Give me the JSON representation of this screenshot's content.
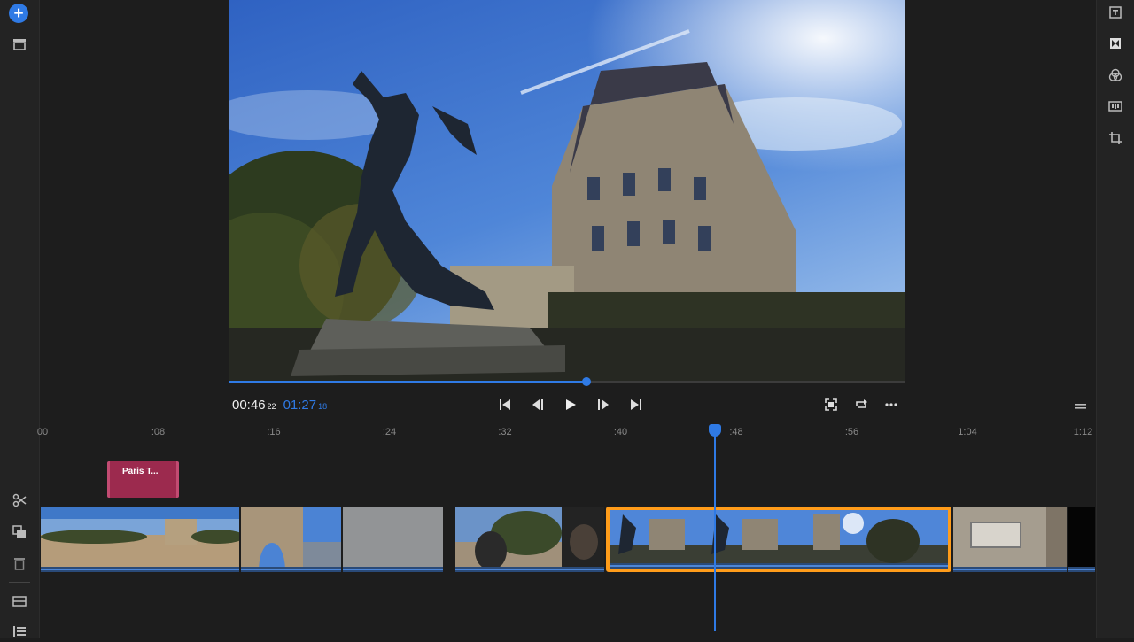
{
  "toolbar_left": {
    "icons": [
      "add-media-icon",
      "media-bin-icon",
      "scissors-icon",
      "duplicate-icon",
      "trash-icon",
      "track-layout-icon",
      "list-view-icon"
    ]
  },
  "toolbar_right": {
    "icons": [
      "text-title-icon",
      "transitions-icon",
      "color-icon",
      "audio-icon",
      "crop-icon"
    ]
  },
  "player": {
    "current_time": "00:46",
    "current_frames": "22",
    "duration": "01:27",
    "duration_frames": "18",
    "progress": 0.53
  },
  "timeline": {
    "ticks": [
      "00",
      ":08",
      ":16",
      ":24",
      ":32",
      ":40",
      ":48",
      ":56",
      "1:04",
      "1:12"
    ],
    "playhead_label": ":48",
    "title_clip_label": "Paris T..."
  },
  "colors": {
    "accent": "#2f7ae5",
    "selection": "#ff9c1a",
    "title_clip": "#9c2a4e"
  }
}
